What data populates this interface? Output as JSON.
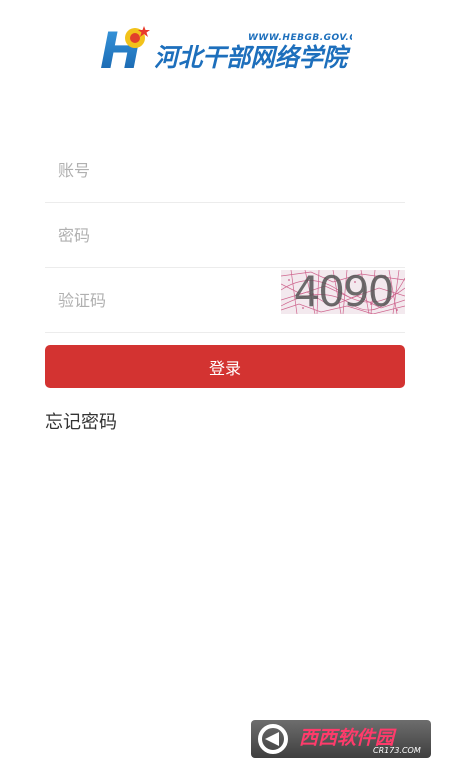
{
  "header": {
    "logo_name": "河北干部网络学院",
    "logo_url_text": "WWW.HEBGB.GOV.CN",
    "logo_letter": "H"
  },
  "form": {
    "account_placeholder": "账号",
    "password_placeholder": "密码",
    "captcha_placeholder": "验证码",
    "captcha_text": "4090"
  },
  "actions": {
    "login_label": "登录",
    "forgot_password_label": "忘记密码"
  },
  "watermark": {
    "site_name": "西西软件园",
    "site_url": "CR173.COM"
  },
  "colors": {
    "primary_button": "#d33331",
    "logo_blue": "#1d6fbc",
    "background": "#ffffff"
  }
}
